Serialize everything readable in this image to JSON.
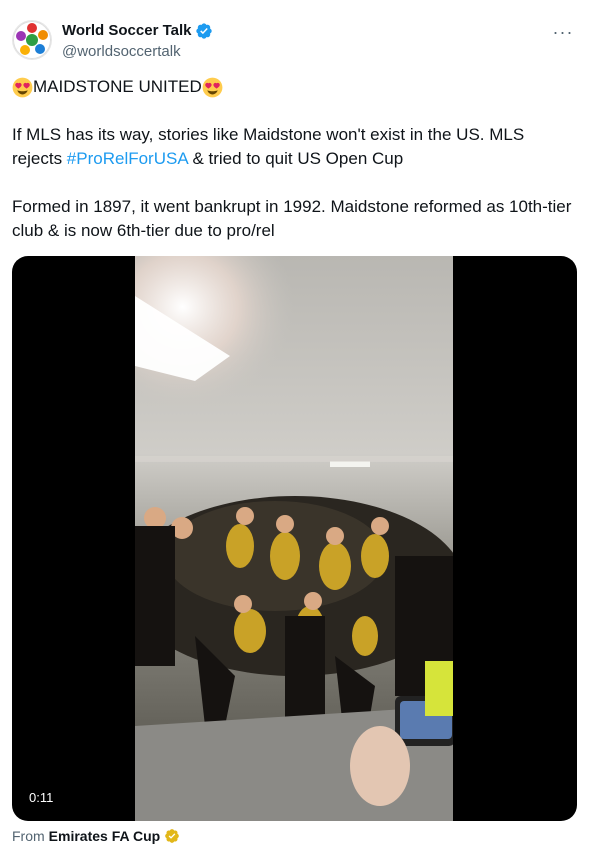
{
  "author": {
    "display_name": "World Soccer Talk",
    "handle": "@worldsoccertalk",
    "verified": true,
    "verified_color": "#1d9bf0"
  },
  "menu": {
    "more_label": "···"
  },
  "tweet": {
    "headline": "MAIDSTONE UNITED",
    "headline_emoji": "heart-eyes-emoji",
    "para1_before": "If MLS has its way, stories like Maidstone won't exist in the US. MLS rejects ",
    "para1_hashtag": "#ProRelForUSA",
    "para1_after": " & tried to quit US Open Cup",
    "para2": "Formed in 1897, it went bankrupt in 1992. Maidstone reformed as 10th-tier club & is now 6th-tier due to pro/rel",
    "hashtag_color": "#1d9bf0"
  },
  "media": {
    "type": "video",
    "duration": "0:11",
    "description_icon": "celebration-video-thumbnail"
  },
  "source": {
    "from_label": "From",
    "channel": "Emirates FA Cup",
    "badge_color": "#e2b719"
  }
}
